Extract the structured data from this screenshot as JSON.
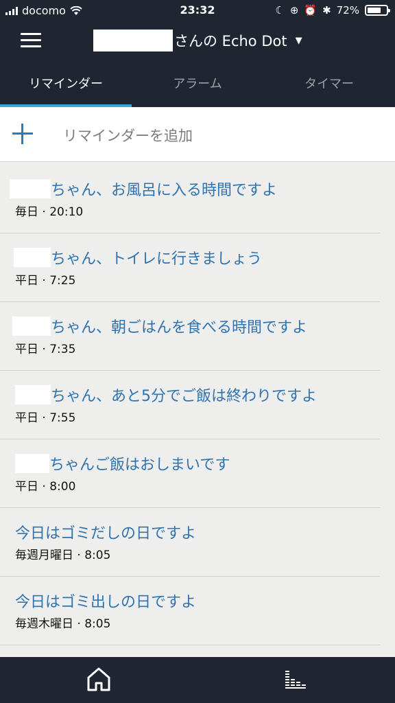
{
  "status_bar": {
    "carrier": "docomo",
    "time": "23:32",
    "battery": "72%",
    "battery_level": 0.72
  },
  "header": {
    "device_title": "さんの Echo Dot",
    "menu_icon": "hamburger-icon",
    "dropdown_icon": "caret-down-icon"
  },
  "tabs": [
    {
      "label": "リマインダー",
      "active": true
    },
    {
      "label": "アラーム",
      "active": false
    },
    {
      "label": "タイマー",
      "active": false
    }
  ],
  "add_reminder": {
    "label": "リマインダーを追加",
    "icon": "plus-icon"
  },
  "reminders": [
    {
      "text": "ちゃん、お風呂に入る時間ですよ",
      "schedule": "毎日 · 20:10",
      "redacted_name": true
    },
    {
      "text": "ちゃん、トイレに行きましょう",
      "schedule": "平日 · 7:25",
      "redacted_name": true
    },
    {
      "text": "ちゃん、朝ごはんを食べる時間ですよ",
      "schedule": "平日 · 7:35",
      "redacted_name": true
    },
    {
      "text": "ちゃん、あと5分でご飯は終わりですよ",
      "schedule": "平日 · 7:55",
      "redacted_name": true
    },
    {
      "text": "ちゃんご飯はおしまいです",
      "schedule": "平日 · 8:00",
      "redacted_name": true
    },
    {
      "text": "今日はゴミだしの日ですよ",
      "schedule": "毎週月曜日 · 8:05",
      "redacted_name": false
    },
    {
      "text": "今日はゴミ出しの日ですよ",
      "schedule": "毎週木曜日 · 8:05",
      "redacted_name": false
    }
  ],
  "bottom_nav": {
    "home_icon": "home-icon",
    "activity_icon": "equalizer-bars-icon"
  },
  "colors": {
    "header_bg": "#1f2631",
    "accent": "#3aa3d8",
    "link_text": "#2f73b0",
    "list_bg": "#eeeeec"
  }
}
